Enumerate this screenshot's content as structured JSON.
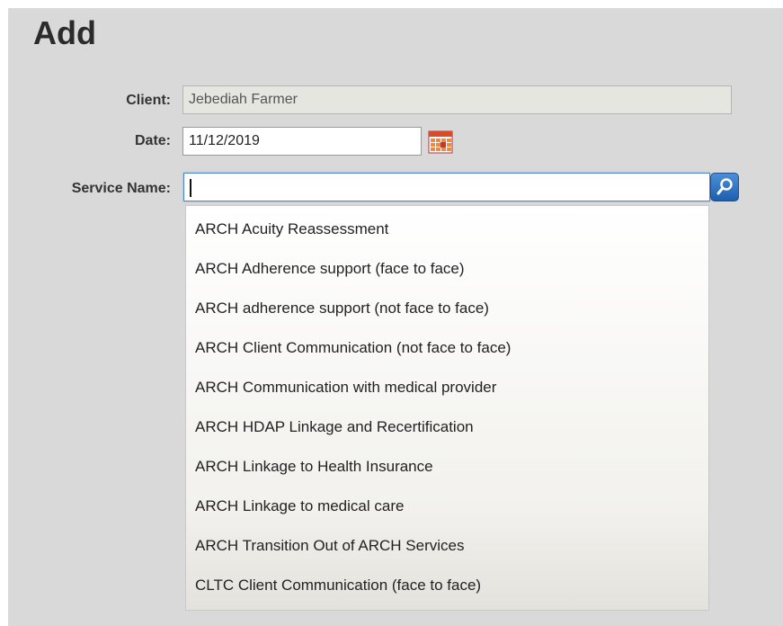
{
  "page": {
    "title": "Add"
  },
  "form": {
    "client": {
      "label": "Client:",
      "value": "Jebediah Farmer"
    },
    "date": {
      "label": "Date:",
      "value": "11/12/2019"
    },
    "service": {
      "label": "Service Name:",
      "value": ""
    }
  },
  "dropdown": {
    "items": [
      "ARCH Acuity Reassessment",
      "ARCH Adherence support (face to face)",
      "ARCH adherence support (not face to face)",
      "ARCH Client Communication (not face to face)",
      "ARCH Communication with medical provider",
      "ARCH HDAP Linkage and Recertification",
      "ARCH Linkage to Health Insurance",
      "ARCH Linkage to medical care",
      "ARCH Transition Out of ARCH Services",
      "CLTC Client Communication (face to face)"
    ]
  },
  "icons": {
    "calendar": "calendar-icon",
    "search": "search-icon"
  },
  "colors": {
    "accent": "#1d5fae",
    "panel": "#d9d9d9"
  }
}
